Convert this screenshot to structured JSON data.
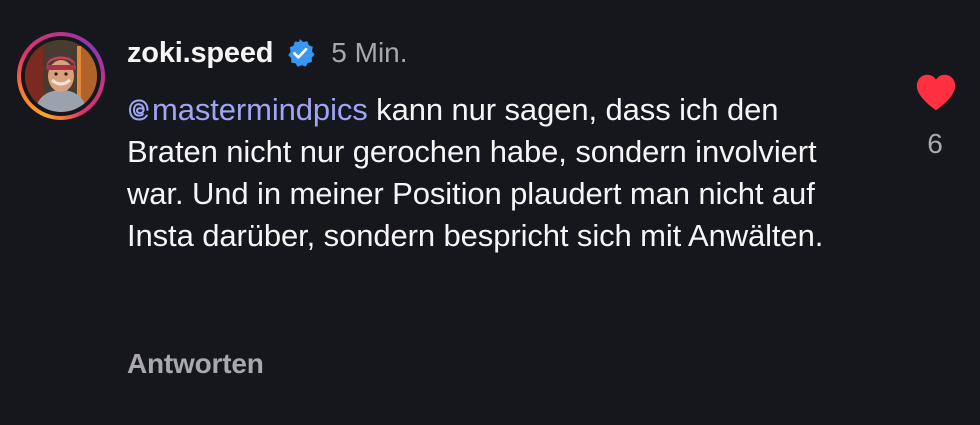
{
  "comment": {
    "username": "zoki.speed",
    "verified_icon": "verified-badge-icon",
    "timestamp": "5 Min.",
    "mention": "mastermindpics",
    "mention_icon": "threads-at-icon",
    "text": " kann nur sagen, dass ich den Braten nicht nur gerochen habe, sondern involviert war. Und in meiner Position plaudert man nicht auf Insta darüber, sondern bespricht sich mit Anwälten.",
    "reply_label": "Antworten",
    "like_icon": "heart-filled-icon",
    "like_count": "6"
  },
  "colors": {
    "background": "#16171c",
    "text": "#f5f5f5",
    "muted": "#a8a8ad",
    "mention": "#a0a4f5",
    "verified": "#3897f0",
    "like": "#ff3040"
  }
}
